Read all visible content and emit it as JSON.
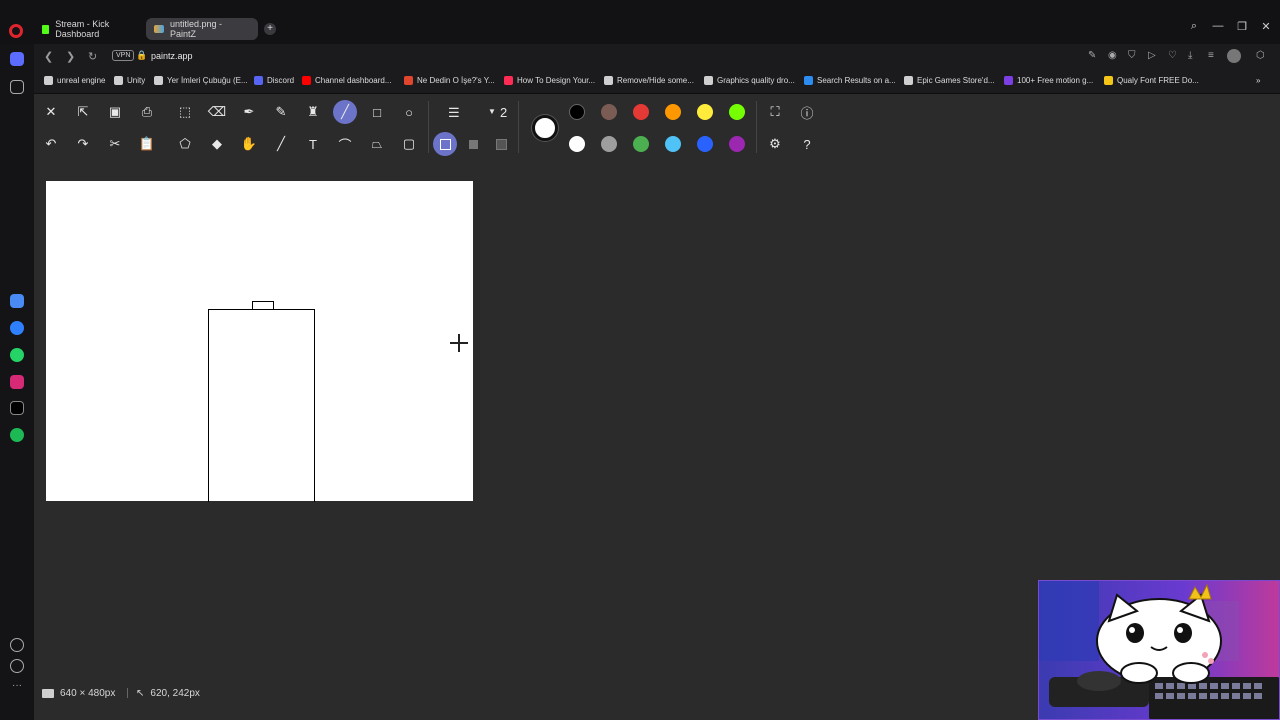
{
  "browser": {
    "tabs": [
      {
        "label": "Stream - Kick Dashboard"
      },
      {
        "label": "untitled.png - PaintZ"
      }
    ],
    "new_tab": "+",
    "url": "paintz.app",
    "vpn_label": "VPN",
    "window_controls": {
      "search": "⌕",
      "minimize": "—",
      "restore": "❐",
      "close": "✕"
    },
    "bookmarks": [
      {
        "label": "unreal engine",
        "icon": "folder-icon",
        "color": "#cfcfcf"
      },
      {
        "label": "Unity",
        "icon": "folder-icon",
        "color": "#cfcfcf"
      },
      {
        "label": "Yer İmleri Çubuğu (E...",
        "icon": "folder-icon",
        "color": "#cfcfcf"
      },
      {
        "label": "Discord",
        "icon": "discord-icon",
        "color": "#5865f2"
      },
      {
        "label": "Channel dashboard...",
        "icon": "youtube-icon",
        "color": "#ff0000"
      },
      {
        "label": "Ne Dedin O İşe?'s Y...",
        "icon": "chart-icon",
        "color": "#e0452e"
      },
      {
        "label": "How To Design Your...",
        "icon": "tiktok-icon",
        "color": "#fe2c55"
      },
      {
        "label": "Remove/Hide some...",
        "icon": "unity-icon",
        "color": "#cfcfcf"
      },
      {
        "label": "Graphics quality dro...",
        "icon": "unity-icon",
        "color": "#cfcfcf"
      },
      {
        "label": "Search Results on a...",
        "icon": "windows-icon",
        "color": "#2d8cf0"
      },
      {
        "label": "Epic Games Store'd...",
        "icon": "epic-icon",
        "color": "#cfcfcf"
      },
      {
        "label": "100+ Free motion g...",
        "icon": "motion-icon",
        "color": "#7b3fe4"
      },
      {
        "label": "Qualy Font FREE Do...",
        "icon": "bolt-icon",
        "color": "#f5c518"
      }
    ]
  },
  "toolbar": {
    "row1": [
      {
        "name": "close-image-icon",
        "glyph": "✕"
      },
      {
        "name": "open-icon",
        "glyph": "⇱"
      },
      {
        "name": "save-icon",
        "glyph": "▣"
      },
      {
        "name": "print-icon",
        "glyph": "⎙"
      },
      {
        "name": "rect-select-icon",
        "glyph": "⬚"
      },
      {
        "name": "eraser-icon",
        "glyph": "⌫"
      },
      {
        "name": "color-picker-icon",
        "glyph": "✒"
      },
      {
        "name": "pencil-icon",
        "glyph": "✎"
      },
      {
        "name": "airbrush-icon",
        "glyph": "♜"
      },
      {
        "name": "line-tool-icon",
        "glyph": "╱"
      },
      {
        "name": "rectangle-tool-icon",
        "glyph": "□"
      },
      {
        "name": "ellipse-tool-icon",
        "glyph": "○"
      }
    ],
    "row2": [
      {
        "name": "undo-icon",
        "glyph": "↶"
      },
      {
        "name": "redo-icon",
        "glyph": "↷"
      },
      {
        "name": "cut-icon",
        "glyph": "✂"
      },
      {
        "name": "paste-icon",
        "glyph": "📋"
      },
      {
        "name": "free-select-icon",
        "glyph": "⬠"
      },
      {
        "name": "fill-bucket-icon",
        "glyph": "◆"
      },
      {
        "name": "hand-pan-icon",
        "glyph": "✋"
      },
      {
        "name": "brush-icon",
        "glyph": "╱"
      },
      {
        "name": "text-tool-icon",
        "glyph": "T"
      },
      {
        "name": "curve-tool-icon",
        "glyph": "⌒"
      },
      {
        "name": "polygon-tool-icon",
        "glyph": "⏢"
      },
      {
        "name": "rounded-rect-tool-icon",
        "glyph": "▢"
      }
    ],
    "stroke_width": "2",
    "fill_modes": [
      "outline",
      "fill",
      "outline-fill"
    ],
    "primary_color": "#ffffff",
    "palette_row1": [
      "#000000",
      "#7a5c55",
      "#e53935",
      "#ff9800",
      "#ffeb3b",
      "#76ff03"
    ],
    "palette_row2": [
      "#ffffff",
      "#9e9e9e",
      "#4caf50",
      "#4fc3f7",
      "#2962ff",
      "#9c27b0"
    ],
    "right_icons": {
      "fullscreen": "⛶",
      "about": "ⓘ",
      "settings": "⚙",
      "help": "?"
    }
  },
  "canvas": {
    "accent": "#6c74c9"
  },
  "status": {
    "image_size": "640 × 480px",
    "cursor_position": "620, 242px"
  }
}
